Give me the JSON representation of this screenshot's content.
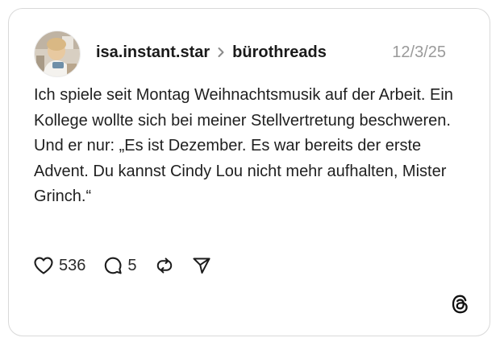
{
  "post": {
    "username": "isa.instant.star",
    "community": "bürothreads",
    "date": "12/3/25",
    "text": "Ich spiele seit Montag Weihnachtsmusik auf der Arbeit. Ein Kollege wollte sich bei meiner Stellvertretung beschweren. Und er nur: „Es ist Dezember. Es war bereits der erste Advent. Du kannst Cindy Lou nicht mehr aufhalten, Mister Grinch.“"
  },
  "actions": {
    "likes": "536",
    "replies": "5"
  },
  "icons": {
    "like": "heart-icon",
    "reply": "speech-bubble-icon",
    "repost": "repost-icon",
    "share": "send-icon",
    "brand": "threads-logo-icon",
    "separator": "chevron-right-icon"
  },
  "colors": {
    "text": "#1f1f1f",
    "muted": "#9a9a9a",
    "border": "#d9d9d9"
  }
}
